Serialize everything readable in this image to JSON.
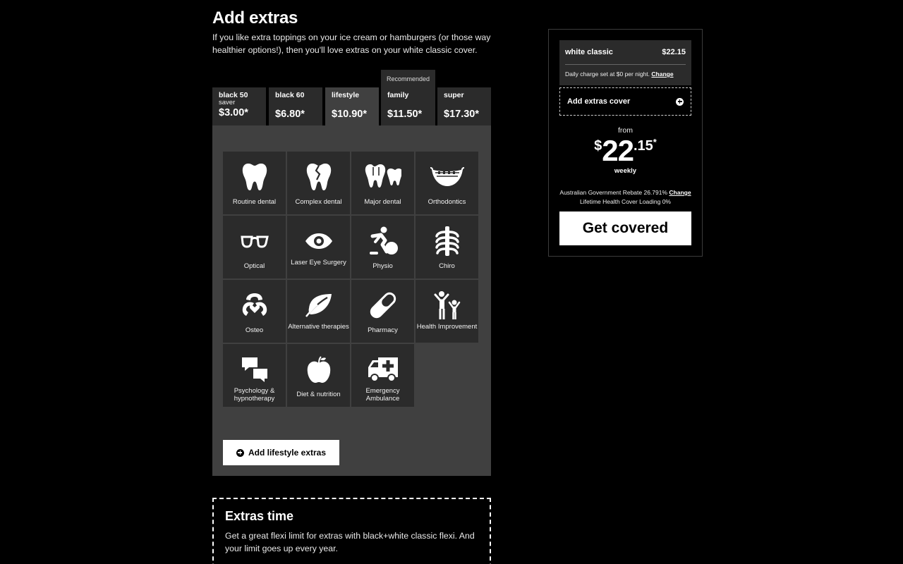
{
  "section": {
    "title": "Add extras",
    "intro": "If you like extra toppings on your ice cream or hamburgers (or those way healthier options!), then you'll love extras on your white classic cover."
  },
  "recommended_badge": "Recommended",
  "tabs": [
    {
      "name": "black 50",
      "sub": "saver",
      "price": "$3.00*"
    },
    {
      "name": "black 60",
      "sub": "",
      "price": "$6.80*"
    },
    {
      "name": "lifestyle",
      "sub": "",
      "price": "$10.90*",
      "active": true
    },
    {
      "name": "family",
      "sub": "",
      "price": "$11.50*"
    },
    {
      "name": "super",
      "sub": "",
      "price": "$17.30*"
    }
  ],
  "extras": [
    {
      "label": "Routine dental",
      "icon": "tooth-icon"
    },
    {
      "label": "Complex dental",
      "icon": "cracked-tooth-icon"
    },
    {
      "label": "Major dental",
      "icon": "teeth-icon"
    },
    {
      "label": "Orthodontics",
      "icon": "braces-smile-icon"
    },
    {
      "label": "Optical",
      "icon": "glasses-icon"
    },
    {
      "label": "Laser Eye Surgery",
      "icon": "eye-icon"
    },
    {
      "label": "Physio",
      "icon": "physio-ball-icon"
    },
    {
      "label": "Chiro",
      "icon": "spine-icon"
    },
    {
      "label": "Osteo",
      "icon": "osteo-heart-icon"
    },
    {
      "label": "Alternative therapies",
      "icon": "leaf-icon"
    },
    {
      "label": "Pharmacy",
      "icon": "pill-icon"
    },
    {
      "label": "Health Improvement",
      "icon": "family-icon"
    },
    {
      "label": "Psychology & hypnotherapy",
      "icon": "speech-bubbles-icon"
    },
    {
      "label": "Diet & nutrition",
      "icon": "apple-icon"
    },
    {
      "label": "Emergency Ambulance",
      "icon": "ambulance-icon"
    }
  ],
  "add_button": "Add lifestyle extras",
  "extras_time": {
    "title": "Extras time",
    "body": "Get a great flexi limit for extras with black+white classic flexi. And your limit goes up every year."
  },
  "summary": {
    "plan_name": "white classic",
    "plan_price": "$22.15",
    "daily_charge": "Daily charge set at $0 per night.",
    "change_label": "Change",
    "add_extras_cover": "Add extras cover",
    "from": "from",
    "price_currency": "$",
    "price_dollars": "22",
    "price_cents": ".15",
    "price_star": "*",
    "period": "weekly",
    "rebate": "Australian Government Rebate 26.791%",
    "rebate_change": "Change",
    "loading": "Lifetime Health Cover Loading 0%",
    "cta": "Get covered"
  },
  "colors": {
    "background": "#000000",
    "panel": "#404040",
    "tile": "#2b2b2b",
    "button": "#ffffff"
  }
}
